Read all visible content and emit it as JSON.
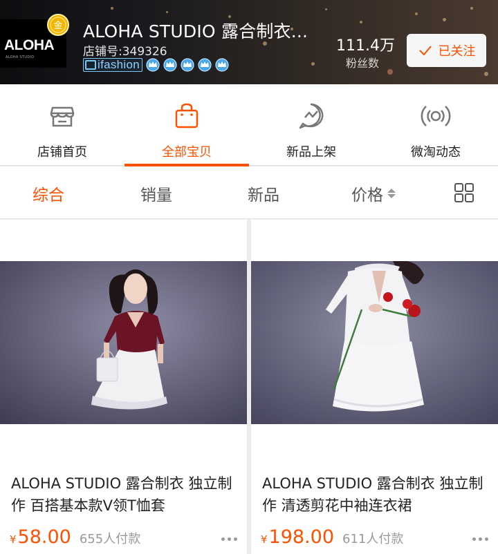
{
  "shop": {
    "logo_text": "ALOHA",
    "logo_sub": "ALOHA STUDIO",
    "medal_char": "金",
    "name": "ALOHA STUDIO 露合制衣...",
    "shop_id": "店铺号:349326",
    "badge": "ifashion",
    "crown_count": 5,
    "fans_count": "111.4万",
    "fans_label": "粉丝数",
    "follow_label": "已关注",
    "accent_color": "#ff5000"
  },
  "nav": {
    "items": [
      {
        "label": "店铺首页",
        "icon": "shop-icon"
      },
      {
        "label": "全部宝贝",
        "icon": "bag-icon"
      },
      {
        "label": "新品上架",
        "icon": "new-arrivals-icon"
      },
      {
        "label": "微淘动态",
        "icon": "broadcast-icon"
      }
    ],
    "active_index": 1
  },
  "sort": {
    "items": [
      "综合",
      "销量",
      "新品",
      "价格"
    ],
    "active": "综合",
    "view_toggle_icon": "grid-view-icon"
  },
  "products": [
    {
      "title": "ALOHA STUDIO 露合制衣 独立制作 百搭基本款V领T恤套",
      "currency": "¥",
      "price": "58.00",
      "sold": "655人付款"
    },
    {
      "title": "ALOHA STUDIO 露合制衣 独立制作 清透剪花中袖连衣裙",
      "currency": "¥",
      "price": "198.00",
      "sold": "611人付款"
    }
  ]
}
